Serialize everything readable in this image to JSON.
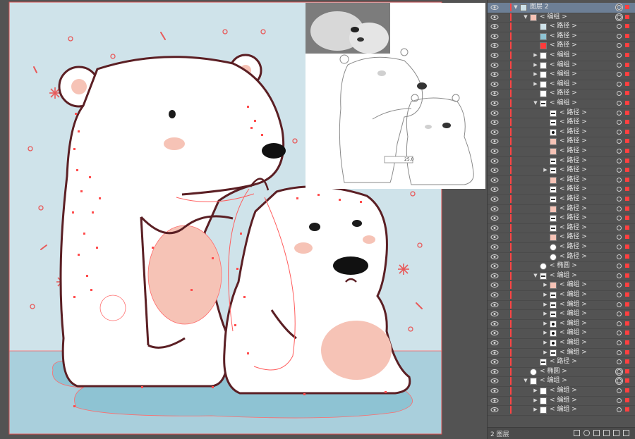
{
  "colors": {
    "sky": "#cfe3ea",
    "ground": "#a9cfdc",
    "water": "#8ec3d3",
    "fur": "#ffffff",
    "outline": "#5b1f24",
    "pink": "#f6c3b6",
    "anchor": "#ff4d4d"
  },
  "reference": {
    "sketch_value": "25.0"
  },
  "layers": {
    "rows": [
      {
        "label": "图层 2",
        "indent": 0,
        "arrow": "open",
        "selected": true,
        "thumb": "photo"
      },
      {
        "label": "< 编组 >",
        "indent": 1,
        "arrow": "open",
        "thumb": "pink"
      },
      {
        "label": "< 路径 >",
        "indent": 2,
        "arrow": "none",
        "thumb": "lightblue"
      },
      {
        "label": "< 路径 >",
        "indent": 2,
        "arrow": "none",
        "thumb": "blue"
      },
      {
        "label": "< 路径 >",
        "indent": 2,
        "arrow": "none",
        "thumb": "red"
      },
      {
        "label": "< 编组 >",
        "indent": 2,
        "arrow": "closed",
        "thumb": "white"
      },
      {
        "label": "< 编组 >",
        "indent": 2,
        "arrow": "closed",
        "thumb": "white"
      },
      {
        "label": "< 编组 >",
        "indent": 2,
        "arrow": "closed",
        "thumb": "white"
      },
      {
        "label": "< 编组 >",
        "indent": 2,
        "arrow": "closed",
        "thumb": "white"
      },
      {
        "label": "< 路径 >",
        "indent": 2,
        "arrow": "none",
        "thumb": "white"
      },
      {
        "label": "< 编组 >",
        "indent": 2,
        "arrow": "open",
        "thumb": "stroke"
      },
      {
        "label": "< 路径 >",
        "indent": 3,
        "arrow": "none",
        "thumb": "stroke"
      },
      {
        "label": "< 路径 >",
        "indent": 3,
        "arrow": "none",
        "thumb": "stroke"
      },
      {
        "label": "< 路径 >",
        "indent": 3,
        "arrow": "none",
        "thumb": "black"
      },
      {
        "label": "< 路径 >",
        "indent": 3,
        "arrow": "none",
        "thumb": "pink"
      },
      {
        "label": "< 路径 >",
        "indent": 3,
        "arrow": "none",
        "thumb": "pink"
      },
      {
        "label": "< 路径 >",
        "indent": 3,
        "arrow": "none",
        "thumb": "stroke"
      },
      {
        "label": "< 路径 >",
        "indent": 3,
        "arrow": "closed",
        "thumb": "stroke"
      },
      {
        "label": "< 路径 >",
        "indent": 3,
        "arrow": "none",
        "thumb": "pink"
      },
      {
        "label": "< 路径 >",
        "indent": 3,
        "arrow": "none",
        "thumb": "stroke"
      },
      {
        "label": "< 路径 >",
        "indent": 3,
        "arrow": "none",
        "thumb": "stroke"
      },
      {
        "label": "< 路径 >",
        "indent": 3,
        "arrow": "none",
        "thumb": "pink"
      },
      {
        "label": "< 路径 >",
        "indent": 3,
        "arrow": "none",
        "thumb": "stroke"
      },
      {
        "label": "< 路径 >",
        "indent": 3,
        "arrow": "none",
        "thumb": "stroke"
      },
      {
        "label": "< 路径 >",
        "indent": 3,
        "arrow": "none",
        "thumb": "pink"
      },
      {
        "label": "< 路径 >",
        "indent": 3,
        "arrow": "none",
        "thumb": "circle"
      },
      {
        "label": "< 路径 >",
        "indent": 3,
        "arrow": "none",
        "thumb": "circle"
      },
      {
        "label": "< 椭圆 >",
        "indent": 2,
        "arrow": "none",
        "thumb": "circle"
      },
      {
        "label": "< 编组 >",
        "indent": 2,
        "arrow": "open",
        "thumb": "stroke"
      },
      {
        "label": "< 编组 >",
        "indent": 3,
        "arrow": "closed",
        "thumb": "pink"
      },
      {
        "label": "< 编组 >",
        "indent": 3,
        "arrow": "closed",
        "thumb": "stroke"
      },
      {
        "label": "< 编组 >",
        "indent": 3,
        "arrow": "closed",
        "thumb": "stroke"
      },
      {
        "label": "< 编组 >",
        "indent": 3,
        "arrow": "closed",
        "thumb": "stroke"
      },
      {
        "label": "< 编组 >",
        "indent": 3,
        "arrow": "closed",
        "thumb": "black"
      },
      {
        "label": "< 编组 >",
        "indent": 3,
        "arrow": "closed",
        "thumb": "black"
      },
      {
        "label": "< 编组 >",
        "indent": 3,
        "arrow": "closed",
        "thumb": "black"
      },
      {
        "label": "< 编组 >",
        "indent": 3,
        "arrow": "closed",
        "thumb": "stroke"
      },
      {
        "label": "< 路径 >",
        "indent": 2,
        "arrow": "none",
        "thumb": "stroke"
      },
      {
        "label": "< 椭圆 >",
        "indent": 1,
        "arrow": "none",
        "thumb": "circle"
      },
      {
        "label": "< 编组 >",
        "indent": 1,
        "arrow": "open",
        "thumb": "white"
      },
      {
        "label": "< 编组 >",
        "indent": 2,
        "arrow": "closed",
        "thumb": "white"
      },
      {
        "label": "< 编组 >",
        "indent": 2,
        "arrow": "closed",
        "thumb": "white"
      },
      {
        "label": "< 编组 >",
        "indent": 2,
        "arrow": "closed",
        "thumb": "white"
      }
    ],
    "footer": {
      "label": "2 图层"
    }
  }
}
